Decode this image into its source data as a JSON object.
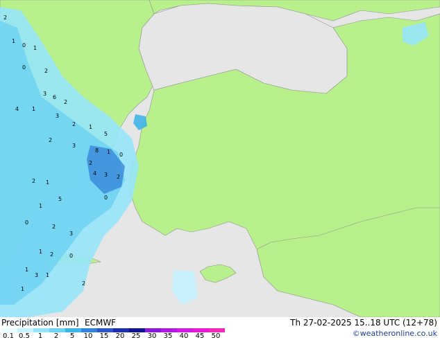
{
  "legend": {
    "title": "Precipitation [mm]",
    "model": "ECMWF",
    "valid_time": "Th 27-02-2025 15..18 UTC (12+78)",
    "credit": "©weatheronline.co.uk",
    "scale": [
      {
        "label": "0.1",
        "color": "#e8fbff"
      },
      {
        "label": "0.5",
        "color": "#c4f2ff"
      },
      {
        "label": "1",
        "color": "#96e4fa"
      },
      {
        "label": "2",
        "color": "#6fd2f2"
      },
      {
        "label": "5",
        "color": "#3fb4e8"
      },
      {
        "label": "10",
        "color": "#3482d8"
      },
      {
        "label": "15",
        "color": "#2d55c8"
      },
      {
        "label": "20",
        "color": "#1e2eaa"
      },
      {
        "label": "25",
        "color": "#10148c"
      },
      {
        "label": "30",
        "color": "#8a1ad8"
      },
      {
        "label": "35",
        "color": "#b01ae0"
      },
      {
        "label": "40",
        "color": "#d01ae0"
      },
      {
        "label": "45",
        "color": "#e61ad2"
      },
      {
        "label": "50",
        "color": "#f02ab8"
      }
    ]
  },
  "map": {
    "sea_color": "#e6e6e6",
    "land_color": "#b8f08c",
    "border_color": "#909090",
    "cell_values": [
      "2",
      "1",
      "0",
      "1",
      "2",
      "0",
      "3",
      "6",
      "2",
      "1",
      "4",
      "3",
      "2",
      "1",
      "5",
      "2",
      "3",
      "8",
      "1",
      "0",
      "2",
      "1",
      "4",
      "3",
      "2",
      "5",
      "1",
      "0",
      "2",
      "3",
      "1",
      "2",
      "0",
      "1",
      "3",
      "2",
      "1",
      "1",
      "0",
      "2"
    ]
  }
}
